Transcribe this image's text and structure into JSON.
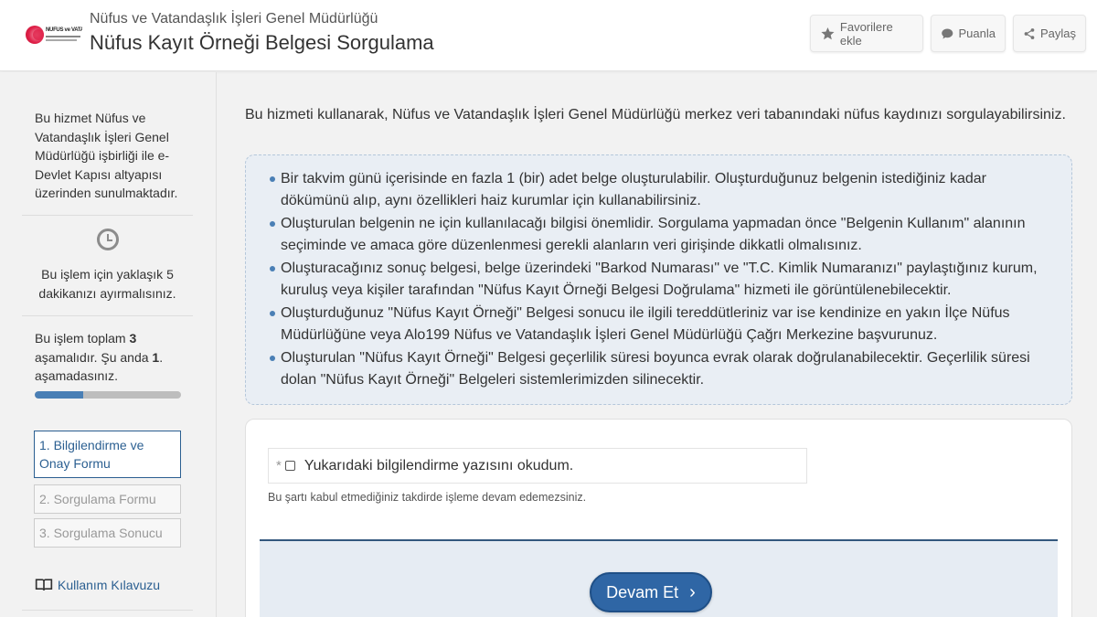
{
  "header": {
    "subtitle": "Nüfus ve Vatandaşlık İşleri Genel Müdürlüğü",
    "title": "Nüfus Kayıt Örneği Belgesi Sorgulama",
    "logo_text": "NÜFUS ve VATANDAŞLIK",
    "buttons": {
      "favorite": "Favorilere ekle",
      "rate": "Puanla",
      "share": "Paylaş"
    },
    "icons": {
      "favorite": "star-icon",
      "rate": "speech-bubble-icon",
      "share": "share-icon"
    }
  },
  "sidebar": {
    "service_info": "Bu hizmet Nüfus ve Vatandaşlık İşleri Genel Müdürlüğü işbirliği ile e-Devlet Kapısı altyapısı üzerinden sunulmaktadır.",
    "time_info": "Bu işlem için yaklaşık 5 dakikanızı ayırmalısınız.",
    "stage_info": {
      "prefix": "Bu işlem toplam ",
      "total": "3",
      "middle": " aşamalıdır. Şu anda ",
      "current": "1",
      "suffix": ". aşamadasınız."
    },
    "progress_fraction": 0.333,
    "steps": [
      {
        "label": "1. Bilgilendirme ve Onay Formu",
        "active": true
      },
      {
        "label": "2. Sorgulama Formu",
        "active": false
      },
      {
        "label": "3. Sorgulama Sonucu",
        "active": false
      }
    ],
    "guide_link": "Kullanım Kılavuzu",
    "icons": {
      "time": "clock-icon",
      "guide": "book-icon"
    }
  },
  "main": {
    "intro": "Bu hizmeti kullanarak, Nüfus ve Vatandaşlık İşleri Genel Müdürlüğü merkez veri tabanındaki nüfus kaydınızı sorgulayabilirsiniz.",
    "info_items": [
      "Bir takvim günü içerisinde en fazla 1 (bir) adet belge oluşturulabilir. Oluşturduğunuz belgenin istediğiniz kadar dökümünü alıp, aynı özellikleri haiz kurumlar için kullanabilirsiniz.",
      "Oluşturulan belgenin ne için kullanılacağı bilgisi önemlidir. Sorgulama yapmadan önce \"Belgenin Kullanım\" alanının seçiminde ve amaca göre düzenlenmesi gerekli alanların veri girişinde dikkatli olmalısınız.",
      "Oluşturacağınız sonuç belgesi, belge üzerindeki \"Barkod Numarası\" ve \"T.C. Kimlik Numaranızı\" paylaştığınız kurum, kuruluş veya kişiler tarafından \"Nüfus Kayıt Örneği Belgesi Doğrulama\" hizmeti ile görüntülenebilecektir.",
      "Oluşturduğunuz \"Nüfus Kayıt Örneği\" Belgesi sonucu ile ilgili tereddütleriniz var ise kendinize en yakın İlçe Nüfus Müdürlüğüne veya Alo199 Nüfus ve Vatandaşlık İşleri Genel Müdürlüğü Çağrı Merkezine başvurunuz.",
      "Oluşturulan \"Nüfus Kayıt Örneği\" Belgesi geçerlilik süresi boyunca evrak olarak doğrulanabilecektir. Geçerlilik süresi dolan \"Nüfus Kayıt Örneği\" Belgeleri sistemlerimizden silinecektir."
    ],
    "form": {
      "required_mark": "*",
      "checkbox_label": "Yukarıdaki bilgilendirme yazısını okudum.",
      "checkbox_checked": false,
      "note": "Bu şartı kabul etmediğiniz takdirde işleme devam edemezsiniz.",
      "submit_label": "Devam Et",
      "submit_icon": "chevron-right-icon"
    }
  },
  "colors": {
    "accent": "#2f66a5",
    "link": "#2b5f91",
    "progress_fill": "#4a7fb5",
    "info_bg": "#e9eef4"
  }
}
